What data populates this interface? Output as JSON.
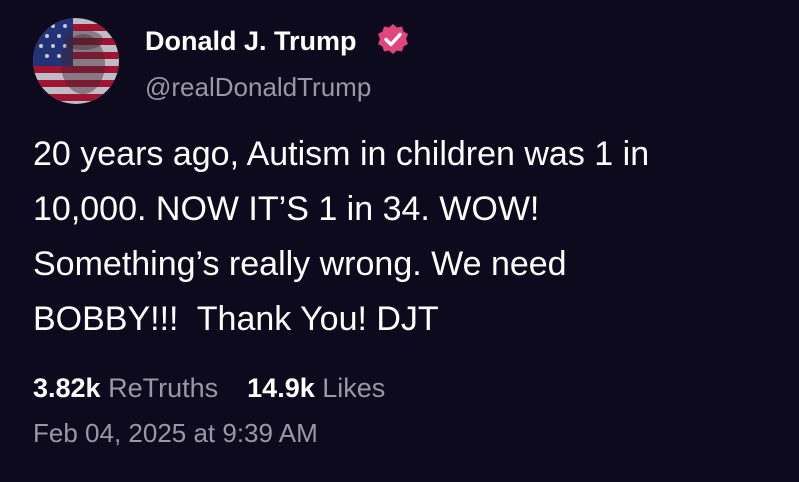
{
  "author": {
    "name": "Donald J. Trump",
    "handle": "@realDonaldTrump",
    "verified_badge_icon": "verified-check-icon",
    "badge_color": "#e0457b"
  },
  "post": {
    "lines": [
      "20 years ago, Autism in children was 1 in",
      "10,000. NOW IT’S 1 in 34. WOW!",
      "Something’s really wrong. We need",
      "BOBBY!!!  Thank You! DJT"
    ]
  },
  "stats": {
    "retruths_count": "3.82k",
    "retruths_label": "ReTruths",
    "likes_count": "14.9k",
    "likes_label": "Likes"
  },
  "timestamp": "Feb 04, 2025 at 9:39 AM",
  "colors": {
    "background": "#0d0a1e",
    "text_primary": "#ffffff",
    "text_secondary": "#9a98a6"
  }
}
